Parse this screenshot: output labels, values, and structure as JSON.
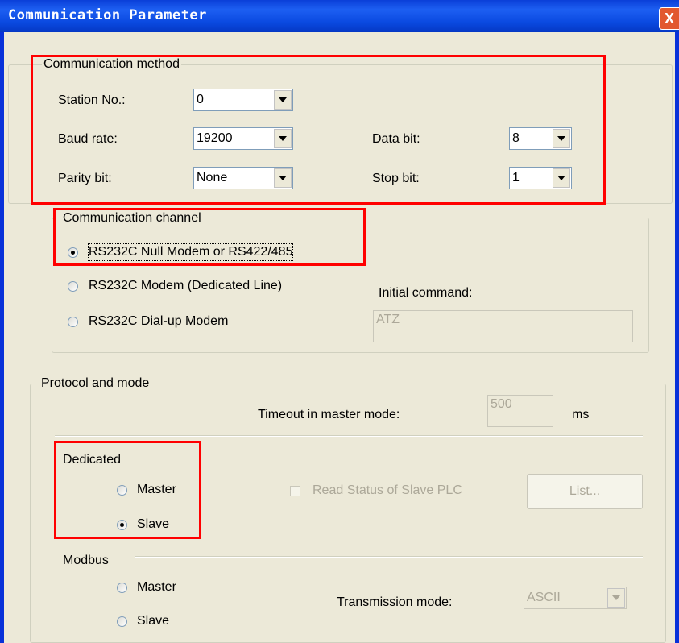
{
  "window": {
    "title": "Communication Parameter",
    "close_glyph": "X"
  },
  "communication_method": {
    "title": "Communication method",
    "station": {
      "label": "Station No.:",
      "value": "0"
    },
    "baud": {
      "label": "Baud rate:",
      "value": "19200"
    },
    "data_bit": {
      "label": "Data bit:",
      "value": "8"
    },
    "parity": {
      "label": "Parity bit:",
      "value": "None"
    },
    "stop_bit": {
      "label": "Stop bit:",
      "value": "1"
    }
  },
  "communication_channel": {
    "title": "Communication channel",
    "options": [
      {
        "label": "RS232C Null Modem or RS422/485",
        "selected": true
      },
      {
        "label": "RS232C Modem (Dedicated Line)",
        "selected": false
      },
      {
        "label": "RS232C Dial-up Modem",
        "selected": false
      }
    ],
    "initial_command": {
      "label": "Initial command:",
      "value": "ATZ"
    }
  },
  "protocol": {
    "title": "Protocol and mode",
    "timeout": {
      "label": "Timeout in master mode:",
      "value": "500",
      "unit": "ms"
    },
    "dedicated": {
      "title": "Dedicated",
      "master": "Master",
      "slave": "Slave",
      "selected": "Slave"
    },
    "read_status": {
      "label": "Read Status of Slave PLC",
      "checked": false
    },
    "list_button": "List...",
    "modbus": {
      "title": "Modbus",
      "master": "Master",
      "slave": "Slave",
      "selected": null
    },
    "transmission": {
      "label": "Transmission mode:",
      "value": "ASCII"
    }
  },
  "colors": {
    "annotation_red": "#ff0000",
    "titlebar_blue": "#0a49e0",
    "dialog_bg": "#ece9d8"
  }
}
